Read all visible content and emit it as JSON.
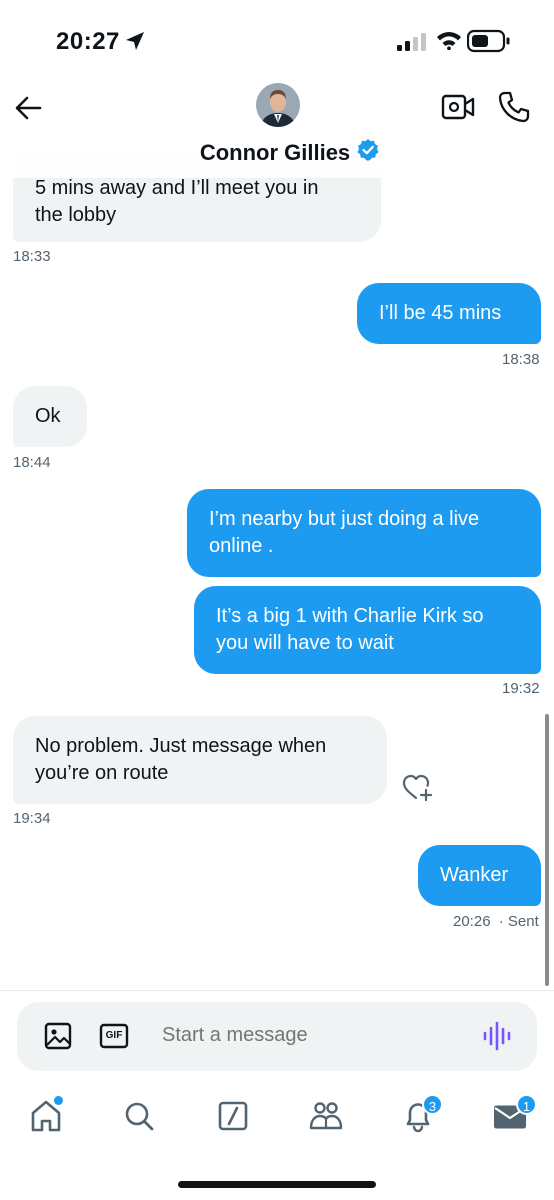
{
  "status_bar": {
    "time": "20:27"
  },
  "header": {
    "back_label": "Back",
    "contact_name": "Connor Gillies",
    "verified": true
  },
  "messages": [
    {
      "id": "m1",
      "side": "in",
      "lines": [
        "5 mins away and I’ll meet you in",
        "the lobby"
      ],
      "time": "18:33"
    },
    {
      "id": "m2",
      "side": "out",
      "lines": [
        "I’ll be 45 mins"
      ],
      "time": "18:38"
    },
    {
      "id": "m3",
      "side": "in",
      "lines": [
        "Ok"
      ],
      "time": "18:44"
    },
    {
      "id": "m4",
      "side": "out",
      "lines": [
        "I’m nearby but just doing a live",
        "online ."
      ],
      "time": ""
    },
    {
      "id": "m5",
      "side": "out",
      "lines": [
        "It’s a big 1 with Charlie Kirk so",
        "you will have to wait"
      ],
      "time": "19:32"
    },
    {
      "id": "m6",
      "side": "in",
      "lines": [
        "No problem. Just message when",
        "you’re on route"
      ],
      "time": "19:34"
    },
    {
      "id": "m7",
      "side": "out",
      "lines": [
        "Wanker"
      ],
      "time": "20:26",
      "status": "· Sent"
    }
  ],
  "composer": {
    "placeholder": "Start a message",
    "gif_label": "GIF"
  },
  "nav": {
    "notifications_badge": "3",
    "messages_badge": "1"
  },
  "colors": {
    "accent": "#1d9bf0",
    "incoming_bubble": "#eff3f4",
    "voice_icon": "#7856ff"
  }
}
